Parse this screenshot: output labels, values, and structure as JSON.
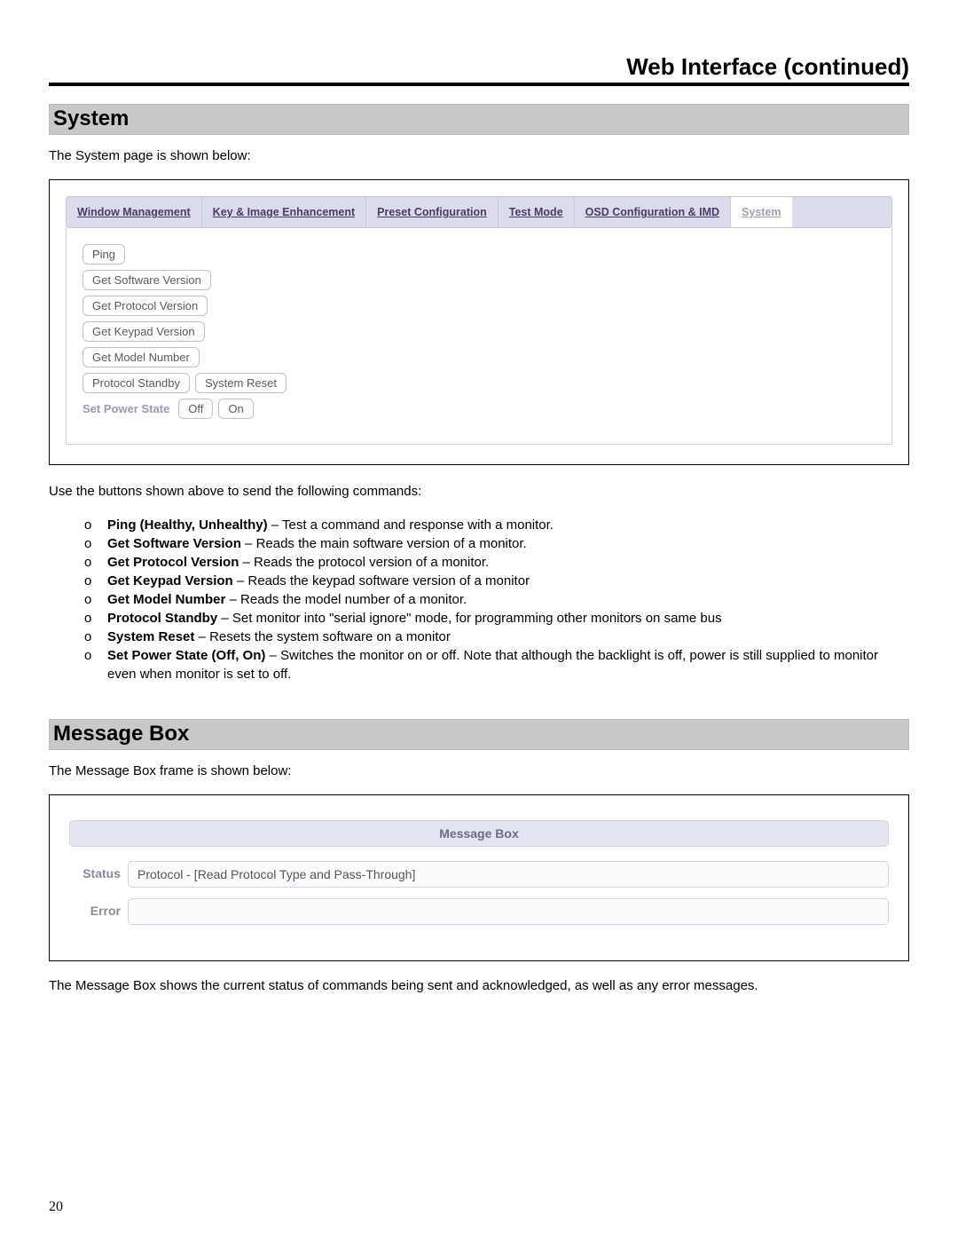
{
  "header": {
    "title": "Web Interface (continued)"
  },
  "section_system": {
    "heading": "System",
    "intro": "The System page is shown below:"
  },
  "nav": {
    "items": [
      "Window Management",
      "Key & Image Enhancement",
      "Preset Configuration",
      "Test Mode",
      "OSD Configuration & IMD",
      "System"
    ],
    "active_index": 5
  },
  "system_buttons": {
    "ping": "Ping",
    "get_software_version": "Get Software Version",
    "get_protocol_version": "Get Protocol Version",
    "get_keypad_version": "Get Keypad Version",
    "get_model_number": "Get Model Number",
    "protocol_standby": "Protocol Standby",
    "system_reset": "System Reset",
    "power_label": "Set Power State",
    "power_off": "Off",
    "power_on": "On"
  },
  "commands_intro": "Use the buttons shown above to send the following commands:",
  "commands": [
    {
      "bold": "Ping (Healthy, Unhealthy)",
      "rest": " – Test a command and response with a monitor."
    },
    {
      "bold": "Get Software Version",
      "rest": " – Reads the main software version of a monitor."
    },
    {
      "bold": "Get Protocol Version",
      "rest": " – Reads the protocol version of a monitor."
    },
    {
      "bold": "Get Keypad Version",
      "rest": " – Reads the keypad software version of a monitor"
    },
    {
      "bold": "Get Model Number",
      "rest": " – Reads the model number of a monitor."
    },
    {
      "bold": "Protocol Standby",
      "rest": " – Set monitor into \"serial ignore\" mode, for programming other monitors on same bus"
    },
    {
      "bold": "System Reset",
      "rest": " – Resets the system software on a monitor"
    },
    {
      "bold": "Set Power State (Off, On)",
      "rest": " – Switches the monitor on or off. Note that although the backlight is off, power is still supplied to monitor even when monitor is set to off."
    }
  ],
  "section_msgbox": {
    "heading": "Message Box",
    "intro": "The Message Box frame is shown below:"
  },
  "msgbox": {
    "title": "Message Box",
    "status_label": "Status",
    "status_value": "Protocol - [Read Protocol Type and Pass-Through]",
    "error_label": "Error",
    "error_value": ""
  },
  "msgbox_outro": "The Message Box shows the current status of commands being sent and acknowledged, as well as any error messages.",
  "page_number": "20"
}
